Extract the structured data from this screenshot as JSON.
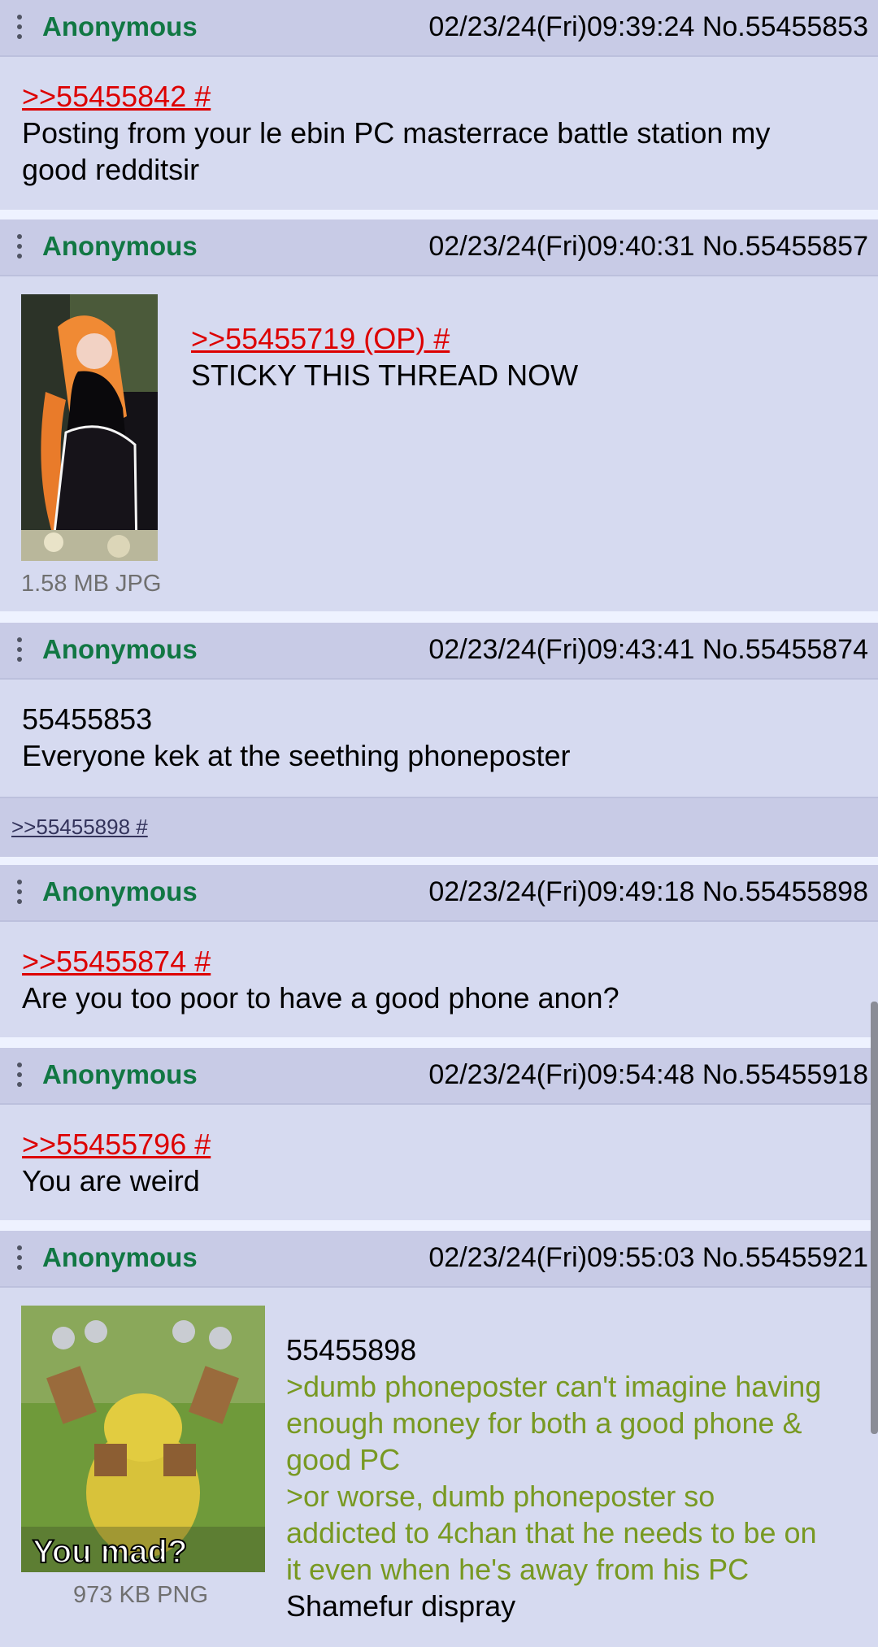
{
  "posts": [
    {
      "author": "Anonymous",
      "date": "02/23/24(Fri)09:39:24",
      "number": "No.55455853",
      "quote": ">>55455842 #",
      "lines": [
        "Posting from your le ebin PC masterrace battle station my",
        "good redditsir"
      ]
    },
    {
      "author": "Anonymous",
      "date": "02/23/24(Fri)09:40:31",
      "number": "No.55455857",
      "quote": ">>55455719 (OP) #",
      "lines": [
        "STICKY THIS THREAD NOW"
      ],
      "file": {
        "info": "1.58 MB JPG",
        "subject": "anime girl with long orange hair in black outfit"
      }
    },
    {
      "author": "Anonymous",
      "date": "02/23/24(Fri)09:43:41",
      "number": "No.55455874",
      "ref": "55455853",
      "lines": [
        "Everyone kek at the seething phoneposter"
      ]
    },
    {
      "author": "Anonymous",
      "date": "02/23/24(Fri)09:49:18",
      "number": "No.55455898",
      "quote": ">>55455874 #",
      "lines": [
        "Are you too poor to have a good phone anon?"
      ]
    },
    {
      "author": "Anonymous",
      "date": "02/23/24(Fri)09:54:48",
      "number": "No.55455918",
      "quote": ">>55455796 #",
      "lines": [
        "You are weird"
      ]
    },
    {
      "author": "Anonymous",
      "date": "02/23/24(Fri)09:55:03",
      "number": "No.55455921",
      "ref": "55455898",
      "greentext": [
        "&gt;dumb phoneposter can't imagine having",
        "enough money for both a good phone &",
        "good PC",
        "&gt;or worse, dumb phoneposter so",
        "addicted to 4chan that he needs to be on",
        "it even when he's away from his PC"
      ],
      "lines": [
        "Shamefur dispray"
      ],
      "file": {
        "info": "973 KB PNG",
        "caption": "You mad?"
      }
    }
  ],
  "replies_link": ">>55455898 #",
  "colors": {
    "name": "#117743",
    "quote": "#dd0000",
    "greentext": "#789922",
    "post_bg": "#d6daf0",
    "header_bg": "#c8cbe6"
  },
  "icons": {
    "post_menu": "vertical-dots-icon"
  }
}
